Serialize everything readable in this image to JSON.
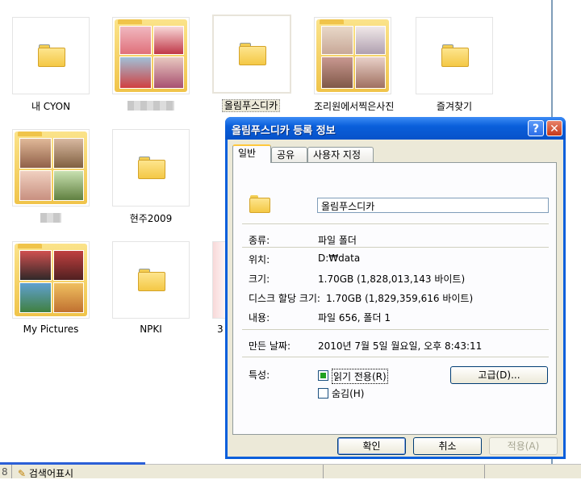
{
  "explorer": {
    "items": [
      {
        "caption": "내 CYON"
      },
      {
        "caption": ""
      },
      {
        "caption": "올림푸스디카"
      },
      {
        "caption": "조리원에서찍은사진"
      },
      {
        "caption": "즐겨찾기"
      },
      {
        "caption": ""
      },
      {
        "caption": "현주2009"
      },
      {
        "caption": "My Pictures"
      },
      {
        "caption": "NPKI"
      },
      {
        "caption": "3"
      }
    ],
    "statusbar": {
      "left_text": "8",
      "item_label": "검색어표시"
    }
  },
  "dialog": {
    "title": "올림푸스디카 등록 정보",
    "help_label": "?",
    "close_label": "✕",
    "tabs": [
      {
        "label": "일반"
      },
      {
        "label": "공유"
      },
      {
        "label": "사용자 지정"
      }
    ],
    "name_value": "올림푸스디카",
    "type_label": "종류:",
    "type_value": "파일 폴더",
    "location_label": "위치:",
    "location_value": "D:₩data",
    "size_label": "크기:",
    "size_value": "1.70GB (1,828,013,143 바이트)",
    "disk_size_label": "디스크 할당 크기:",
    "disk_size_value": "1.70GB (1,829,359,616 바이트)",
    "contains_label": "내용:",
    "contains_value": "파일 656, 폴더 1",
    "created_label": "만든 날짜:",
    "created_value": "2010년 7월 5일 월요일, 오후 8:43:11",
    "attributes_label": "특성:",
    "readonly_label": "읽기 전용(R)",
    "hidden_label": "숨김(H)",
    "advanced_label": "고급(D)...",
    "ok_label": "확인",
    "cancel_label": "취소",
    "apply_label": "적용(A)"
  }
}
